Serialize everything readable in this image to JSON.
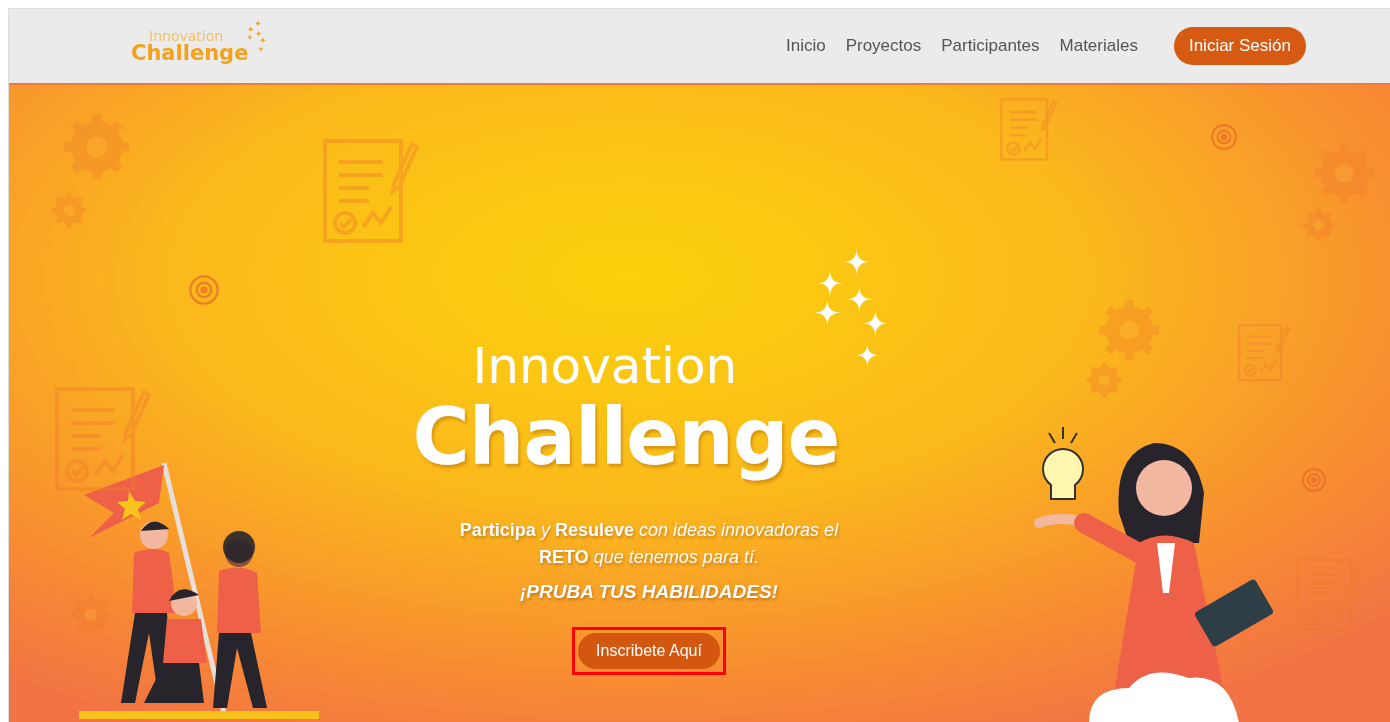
{
  "header": {
    "logo": {
      "top": "Innovation",
      "bottom": "Challenge"
    },
    "nav": [
      {
        "label": "Inicio"
      },
      {
        "label": "Proyectos"
      },
      {
        "label": "Participantes"
      },
      {
        "label": "Materiales"
      }
    ],
    "login_button": "Iniciar Sesión"
  },
  "hero": {
    "logo": {
      "top": "Innovation",
      "bottom": "Challenge"
    },
    "tagline": "**Participa** y **Resuleve** con ideas innovadoras el **RETO** que tenemos para tí.",
    "slogan": "¡PRUBA TUS HABILIDADES!",
    "cta": {
      "label": "Inscribete Aquí",
      "highlighted": true
    }
  }
}
